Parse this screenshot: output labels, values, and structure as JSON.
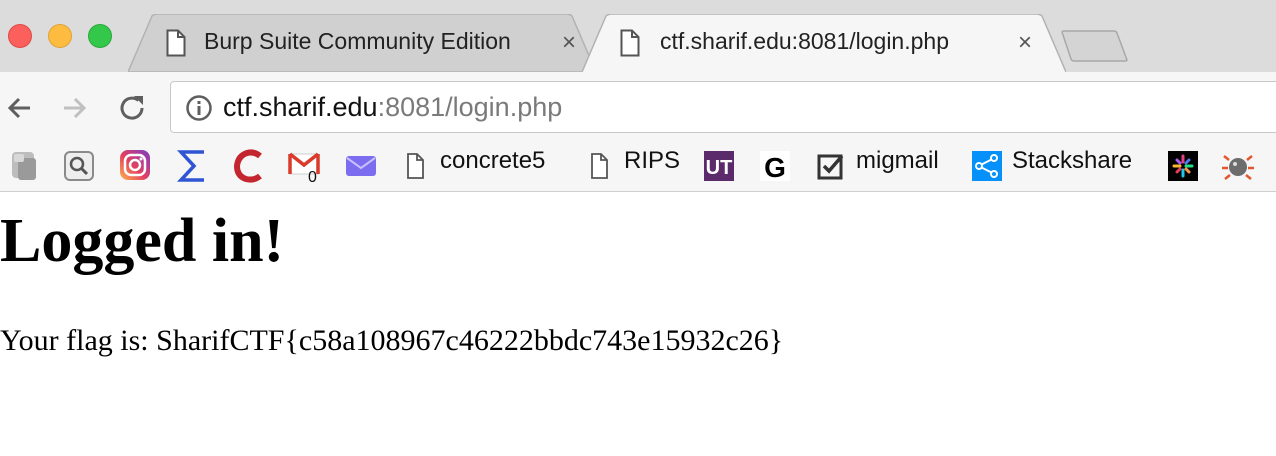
{
  "browser": {
    "tabs": [
      {
        "title": "Burp Suite Community Edition",
        "active": false,
        "close_glyph": "×"
      },
      {
        "title": "ctf.sharif.edu:8081/login.php",
        "active": true,
        "close_glyph": "×"
      }
    ],
    "address_bar": {
      "host": "ctf.sharif.edu",
      "rest": ":8081/login.php"
    },
    "bookmarks": [
      {
        "icon": "generic-gray-bookmark-icon",
        "label": ""
      },
      {
        "icon": "magnifier-bookmark-icon",
        "label": ""
      },
      {
        "icon": "instagram-icon",
        "label": ""
      },
      {
        "icon": "sigma-icon",
        "label": ""
      },
      {
        "icon": "red-c-icon",
        "label": ""
      },
      {
        "icon": "gmail-icon",
        "label": "",
        "badge": "0"
      },
      {
        "icon": "mail-envelope-icon",
        "label": ""
      },
      {
        "icon": "page-icon",
        "label": "concrete5"
      },
      {
        "icon": "page-icon",
        "label": "RIPS"
      },
      {
        "icon": "ut-logo-icon",
        "label": "",
        "logo_text": "UT"
      },
      {
        "icon": "google-g-icon",
        "label": "",
        "logo_text": "G"
      },
      {
        "icon": "migmail-icon",
        "label": "migmail"
      },
      {
        "icon": "stackshare-icon",
        "label": "Stackshare"
      },
      {
        "icon": "starburst-icon",
        "label": ""
      },
      {
        "icon": "bug-icon",
        "label": ""
      }
    ],
    "colors": {
      "tabstrip": "#dcdcdc",
      "toolbar": "#f6f6f6",
      "close_red": "#fc605c",
      "minimize_yellow": "#fdbc40",
      "zoom_green": "#34c84a"
    }
  },
  "page": {
    "heading": "Logged in!",
    "message": "Your flag is: SharifCTF{c58a108967c46222bbdc743e15932c26}"
  }
}
